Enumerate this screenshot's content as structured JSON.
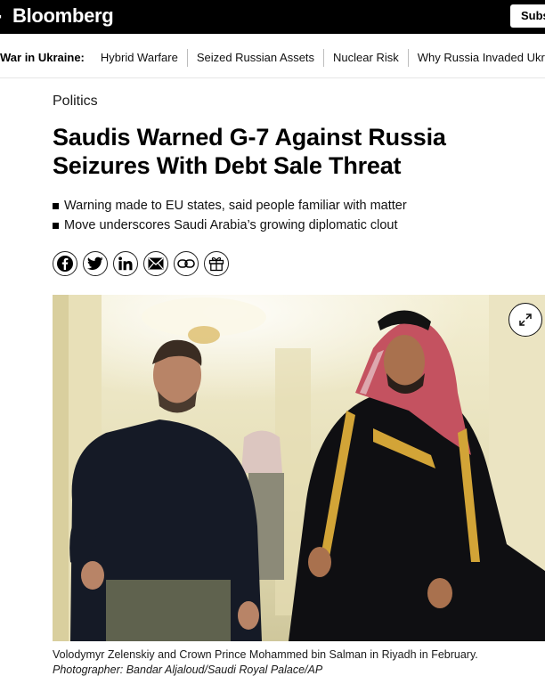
{
  "header": {
    "logo": "Bloomberg",
    "subscribe_label": "Subs"
  },
  "topic_bar": {
    "label": "War in Ukraine:",
    "links": [
      "Hybrid Warfare",
      "Seized Russian Assets",
      "Nuclear Risk",
      "Why Russia Invaded Ukraine"
    ]
  },
  "article": {
    "section": "Politics",
    "headline": "Saudis Warned G-7 Against Russia Seizures With Debt Sale Threat",
    "bullets": [
      "Warning made to EU states, said people familiar with matter",
      "Move underscores Saudi Arabia’s growing diplomatic clout"
    ]
  },
  "share_icons": [
    "facebook-icon",
    "twitter-icon",
    "linkedin-icon",
    "email-icon",
    "link-icon",
    "gift-icon"
  ],
  "photo": {
    "caption": "Volodymyr Zelenskiy and Crown Prince Mohammed bin Salman in Riyadh in February.",
    "credit": "Photographer: Bandar Aljaloud/Saudi Royal Palace/AP"
  },
  "colors": {
    "header_bg": "#000000",
    "text": "#000000",
    "background": "#ffffff"
  }
}
